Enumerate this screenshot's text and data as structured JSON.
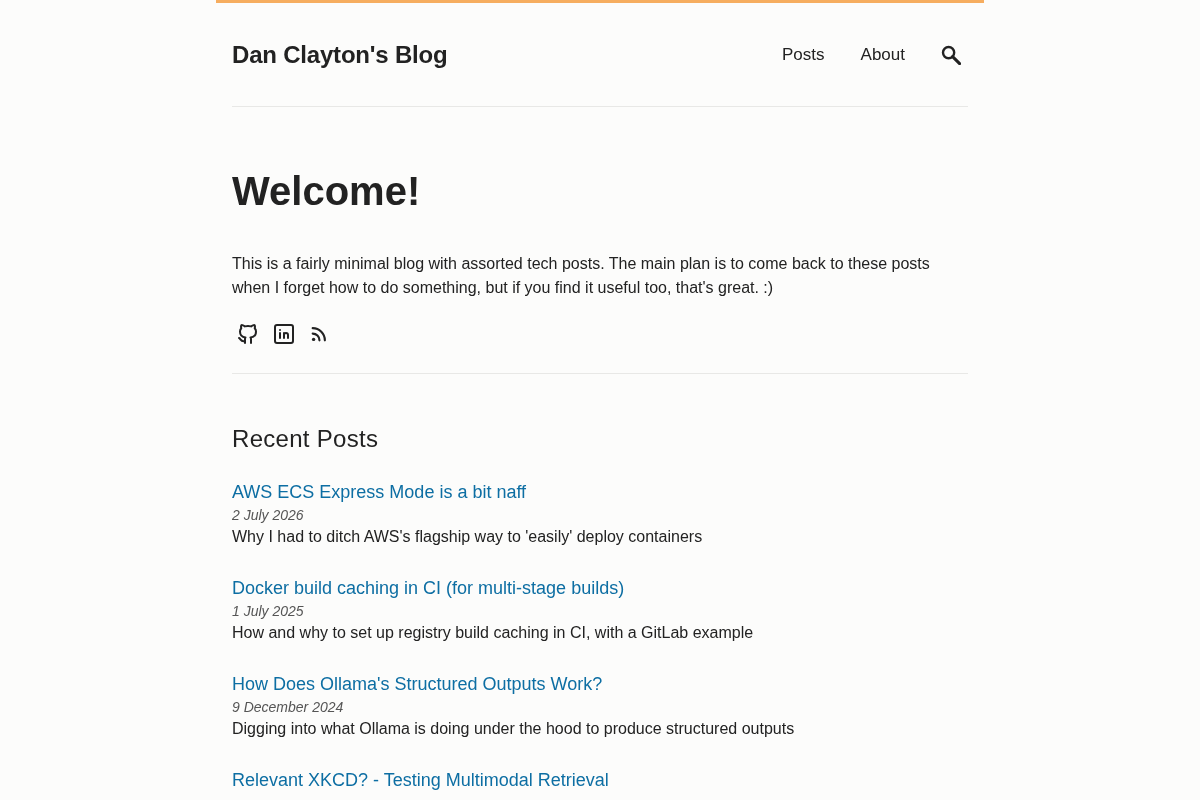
{
  "header": {
    "title": "Dan Clayton's Blog",
    "nav": [
      "Posts",
      "About"
    ]
  },
  "intro": {
    "heading": "Welcome!",
    "text": "This is a fairly minimal blog with assorted tech posts. The main plan is to come back to these posts when I forget how to do something, but if you find it useful too, that's great. :)"
  },
  "recent_posts": {
    "heading": "Recent Posts",
    "posts": [
      {
        "title": "AWS ECS Express Mode is a bit naff",
        "date": "2 July 2026",
        "summary": "Why I had to ditch AWS's flagship way to 'easily' deploy containers"
      },
      {
        "title": "Docker build caching in CI (for multi-stage builds)",
        "date": "1 July 2025",
        "summary": "How and why to set up registry build caching in CI, with a GitLab example"
      },
      {
        "title": "How Does Ollama's Structured Outputs Work?",
        "date": "9 December 2024",
        "summary": "Digging into what Ollama is doing under the hood to produce structured outputs"
      },
      {
        "title": "Relevant XKCD? - Testing Multimodal Retrieval"
      }
    ]
  }
}
